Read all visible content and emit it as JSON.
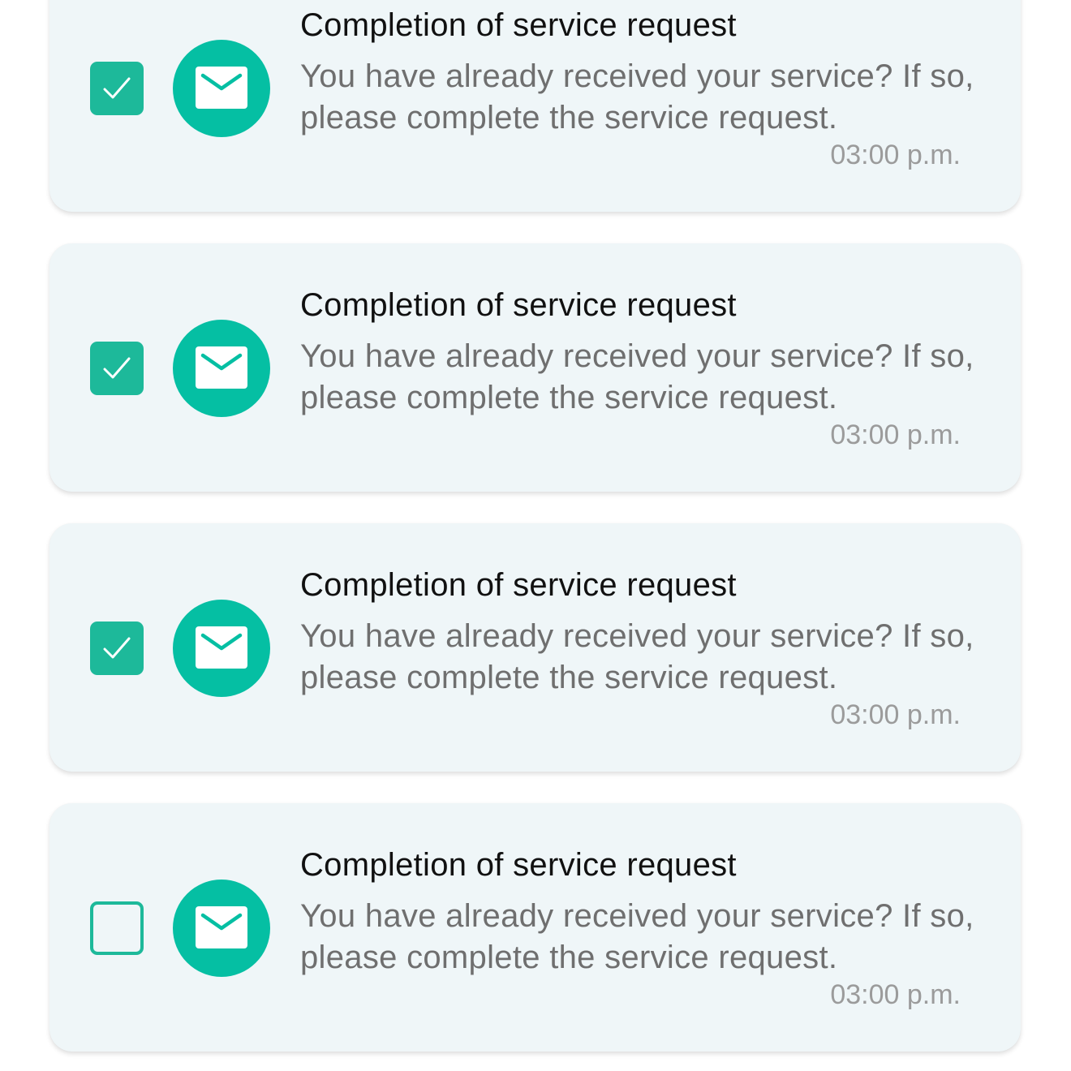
{
  "accent_color": "#05bfa3",
  "checkbox_color": "#1db99a",
  "notifications": [
    {
      "checked": true,
      "icon": "envelope-icon",
      "title": "Completion of service request",
      "message": "You have already received your service? If so, please complete the service request.",
      "time": "03:00 p.m."
    },
    {
      "checked": true,
      "icon": "envelope-icon",
      "title": "Completion of service request",
      "message": "You have already received your service? If so, please complete the service request.",
      "time": "03:00 p.m."
    },
    {
      "checked": true,
      "icon": "envelope-icon",
      "title": "Completion of service request",
      "message": "You have already received your service? If so, please complete the service request.",
      "time": "03:00 p.m."
    },
    {
      "checked": false,
      "icon": "envelope-icon",
      "title": "Completion of service request",
      "message": "You have already received your service? If so, please complete the service request.",
      "time": "03:00 p.m."
    }
  ]
}
